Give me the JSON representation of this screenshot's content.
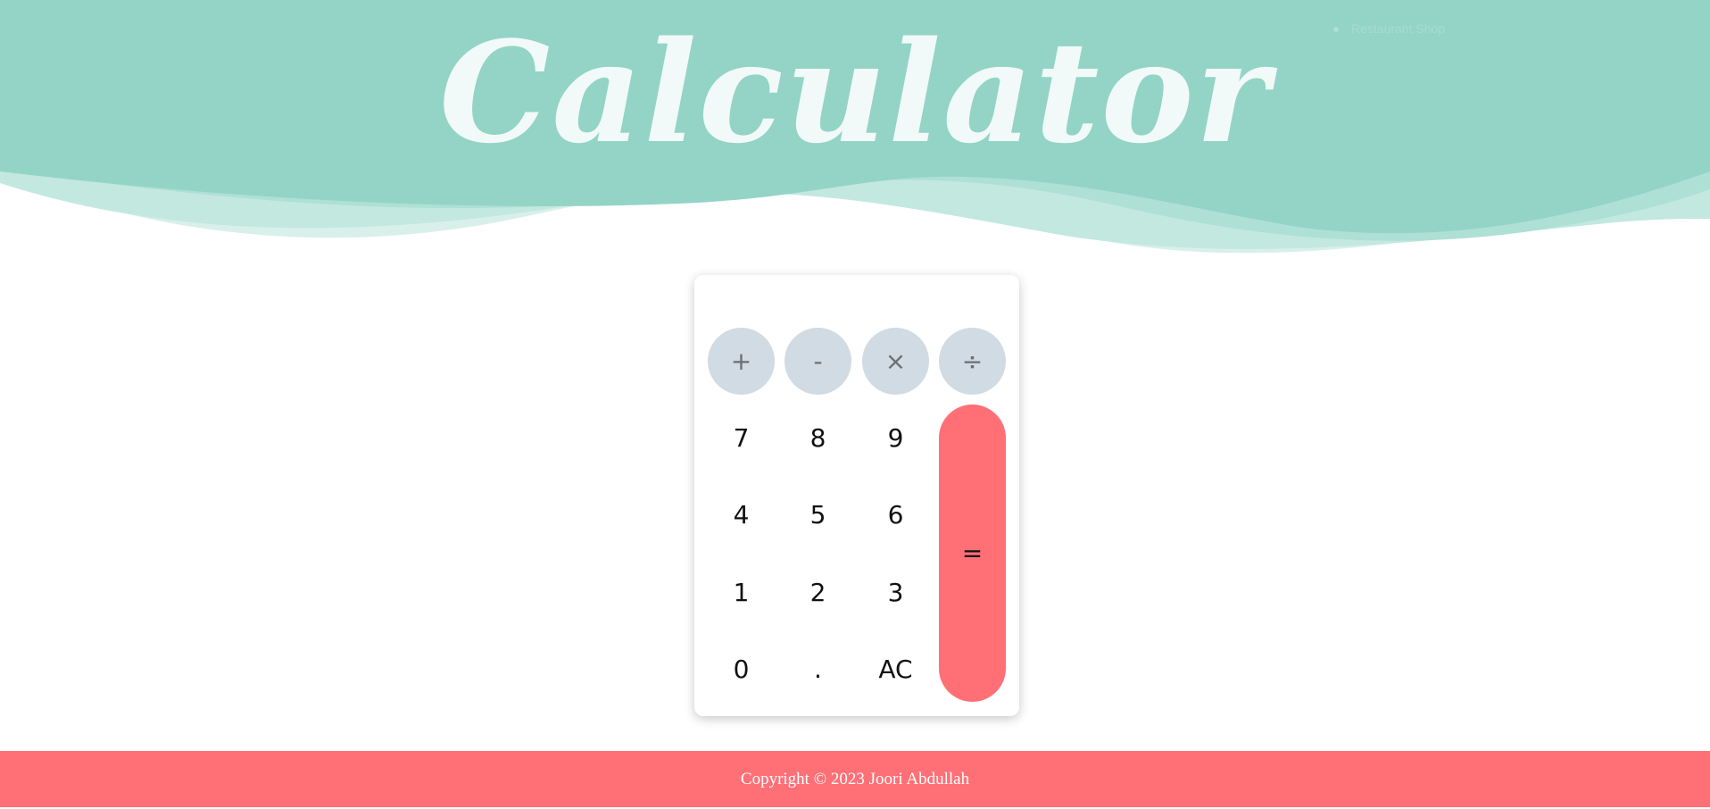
{
  "header": {
    "title": "Calculator",
    "ghost_link": "Restaurant Shop"
  },
  "calculator": {
    "display_value": "",
    "operators": [
      "+",
      "-",
      "×",
      "÷"
    ],
    "digits": {
      "row1": [
        "7",
        "8",
        "9"
      ],
      "row2": [
        "4",
        "5",
        "6"
      ],
      "row3": [
        "1",
        "2",
        "3"
      ],
      "row4": [
        "0",
        ".",
        "AC"
      ]
    },
    "equals": "="
  },
  "footer": {
    "copyright": "Copyright © 2023",
    "author": "Joori Abdullah"
  },
  "colors": {
    "header_teal": "#93d4c6",
    "accent_coral": "#ff6f76",
    "operator_gray": "#d1dbe3"
  }
}
